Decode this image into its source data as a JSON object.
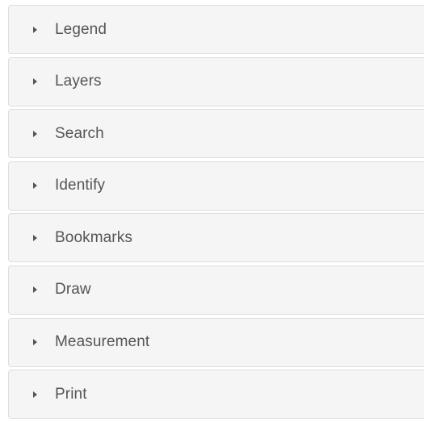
{
  "panels": [
    {
      "label": "Legend"
    },
    {
      "label": "Layers"
    },
    {
      "label": "Search"
    },
    {
      "label": "Identify"
    },
    {
      "label": "Bookmarks"
    },
    {
      "label": "Draw"
    },
    {
      "label": "Measurement"
    },
    {
      "label": "Print"
    }
  ],
  "icons": {
    "collapsed": "caret-right-icon"
  },
  "colors": {
    "panel_bg": "#f5f5f5",
    "panel_border": "#dddddd",
    "text": "#555555"
  }
}
